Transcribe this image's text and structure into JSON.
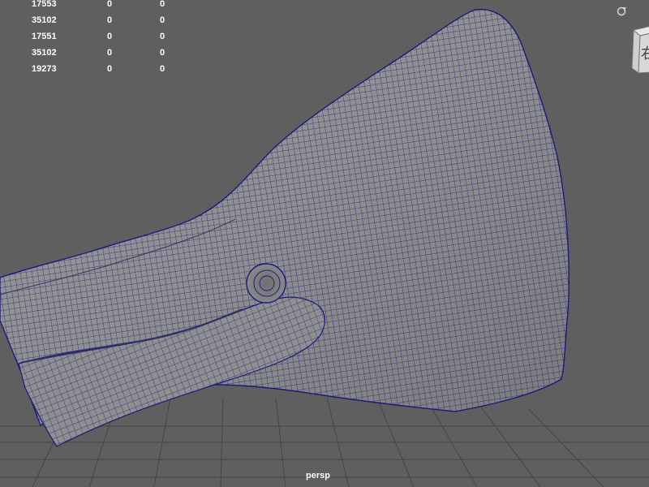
{
  "hud": {
    "rows": [
      {
        "a": "17553",
        "b": "0",
        "c": "0"
      },
      {
        "a": "35102",
        "b": "0",
        "c": "0"
      },
      {
        "a": "17551",
        "b": "0",
        "c": "0"
      },
      {
        "a": "35102",
        "b": "0",
        "c": "0"
      },
      {
        "a": "19273",
        "b": "0",
        "c": "0"
      }
    ]
  },
  "viewport": {
    "camera_label": "persp",
    "background_color": "#5f5f5f",
    "grid_color": "#3f3f3f",
    "wire_color": "#1b1b7d"
  },
  "view_cube": {
    "face_label": "右"
  }
}
